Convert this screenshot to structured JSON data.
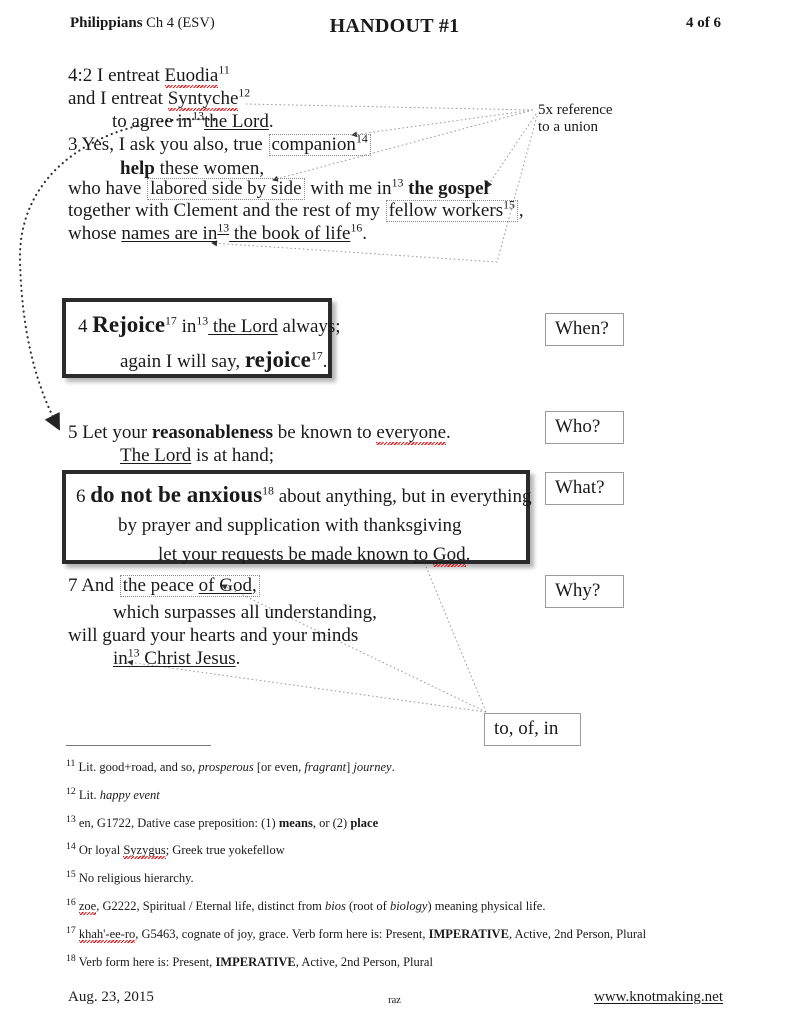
{
  "header": {
    "book": "Philippians",
    "chapter": " Ch 4 (ESV)",
    "title": "HANDOUT #1",
    "page": "4 of 6"
  },
  "scripture": {
    "v2_l1_a": "4:2 I entreat ",
    "v2_l1_name": "Euodia",
    "v2_l1_fn": "11",
    "v2_l2_a": "and I entreat ",
    "v2_l2_name": "Syntyche",
    "v2_l2_fn": "12",
    "v2_l3_a": "to agree in",
    "v2_l3_fn": "13",
    "v2_l3_b": "the Lord",
    "v2_l3_c": ".",
    "v3_l1_a": "3 Yes, I ask you also, true ",
    "v3_l1_box": "companion",
    "v3_l1_fn": "14",
    "v3_l2_bold": "help",
    "v3_l2_b": " these women,",
    "v3_l3_a": "who have ",
    "v3_l3_box": "labored side by side",
    "v3_l3_b": " with me in",
    "v3_l3_fn": "13",
    "v3_l3_bold": "the gospel",
    "v3_l4_a": "together with Clement and the rest of my ",
    "v3_l4_box": "fellow workers",
    "v3_l4_fn": "15",
    "v3_l4_b": ",",
    "v3_l5_a": "whose ",
    "v3_l5_ul1": "names are in",
    "v3_l5_fn": "13",
    "v3_l5_ul2": " the book of life",
    "v3_l5_fn2": "16",
    "v3_l5_b": ".",
    "v4_num": "4 ",
    "v4_big1": "Rejoice",
    "v4_fn1": "17",
    "v4_a": " in",
    "v4_fn2": "13",
    "v4_ul": " the Lord",
    "v4_b": " always;",
    "v4_l2_a": "again I will say, ",
    "v4_big2": "rejoice",
    "v4_fn3": "17",
    "v4_l2_b": ".",
    "v5_l1_a": "5 Let your ",
    "v5_l1_bold": "reasonableness",
    "v5_l1_b": " be known to ",
    "v5_l1_sq": "everyone",
    "v5_l1_c": ".",
    "v5_l2_ul": "The Lord",
    "v5_l2_b": " is at hand;",
    "v6_num": "6 ",
    "v6_big": "do not be anxious",
    "v6_fn": "18",
    "v6_a": " about anything, but in everything",
    "v6_l2": "by prayer and supplication with thanksgiving",
    "v6_l3_a": "let your requests be made known ",
    "v6_l3_ul_a": "to ",
    "v6_l3_ul_sq": "God",
    "v6_l3_b": ".",
    "v7_l1_a": "7 And ",
    "v7_l1_box_a": "the peace ",
    "v7_l1_box_ul": "of God",
    "v7_l1_box_b": ",",
    "v7_l2": "which surpasses all understanding,",
    "v7_l3": "will guard your hearts and your minds",
    "v7_l4_ul_a": "in",
    "v7_l4_fn": "13",
    "v7_l4_ul_b": " Christ Jesus",
    "v7_l4_b": "."
  },
  "callouts": {
    "union_l1": "5x reference",
    "union_l2": "to a union",
    "when": "When?",
    "who": "Who?",
    "what": "What?",
    "why": "Why?",
    "prepositions": "to, of, in"
  },
  "footnotes": [
    {
      "num": "11",
      "parts": [
        {
          "t": "Lit. good+road, and so, ",
          "s": "n"
        },
        {
          "t": "prosperous",
          "s": "i"
        },
        {
          "t": " [or even, ",
          "s": "n"
        },
        {
          "t": "fragrant",
          "s": "i"
        },
        {
          "t": "] ",
          "s": "n"
        },
        {
          "t": "journey",
          "s": "i"
        },
        {
          "t": ".",
          "s": "n"
        }
      ]
    },
    {
      "num": "12",
      "parts": [
        {
          "t": "Lit. ",
          "s": "n"
        },
        {
          "t": "happy event",
          "s": "i"
        }
      ]
    },
    {
      "num": "13",
      "parts": [
        {
          "t": "en, G1722, Dative case preposition:  (1) ",
          "s": "n"
        },
        {
          "t": "means",
          "s": "b"
        },
        {
          "t": ", or (2) ",
          "s": "n"
        },
        {
          "t": "place",
          "s": "b"
        }
      ]
    },
    {
      "num": "14",
      "parts": [
        {
          "t": "Or loyal ",
          "s": "n"
        },
        {
          "t": "Syzygus",
          "s": "q"
        },
        {
          "t": "; Greek true yokefellow",
          "s": "n"
        }
      ]
    },
    {
      "num": "15",
      "parts": [
        {
          "t": "No religious hierarchy.",
          "s": "n"
        }
      ]
    },
    {
      "num": "16",
      "parts": [
        {
          "t": "zoe",
          "s": "q"
        },
        {
          "t": ", G2222, Spiritual / Eternal life, distinct from ",
          "s": "n"
        },
        {
          "t": "bios",
          "s": "i"
        },
        {
          "t": " (root of ",
          "s": "n"
        },
        {
          "t": "biology",
          "s": "i"
        },
        {
          "t": ") meaning physical life.",
          "s": "n"
        }
      ]
    },
    {
      "num": "17",
      "parts": [
        {
          "t": "khah'-ee-ro",
          "s": "q"
        },
        {
          "t": ", G5463, cognate of joy, grace.  Verb form here is:  Present, ",
          "s": "n"
        },
        {
          "t": "IMPERATIVE",
          "s": "b"
        },
        {
          "t": ", Active, 2nd Person, Plural",
          "s": "n"
        }
      ]
    },
    {
      "num": "18",
      "parts": [
        {
          "t": "Verb form here is:  Present, ",
          "s": "n"
        },
        {
          "t": "IMPERATIVE",
          "s": "b"
        },
        {
          "t": ", Active, 2nd Person, Plural",
          "s": "n"
        }
      ]
    }
  ],
  "footer": {
    "date": "Aug. 23,  2015",
    "initials": "raz",
    "site": "www.knotmaking.net"
  },
  "colors": {
    "spellcheck": "#e01b1b",
    "heavy_border": "#2b2b2b",
    "connector": "#9a9a9a",
    "callout_border": "#9a9a9a"
  }
}
